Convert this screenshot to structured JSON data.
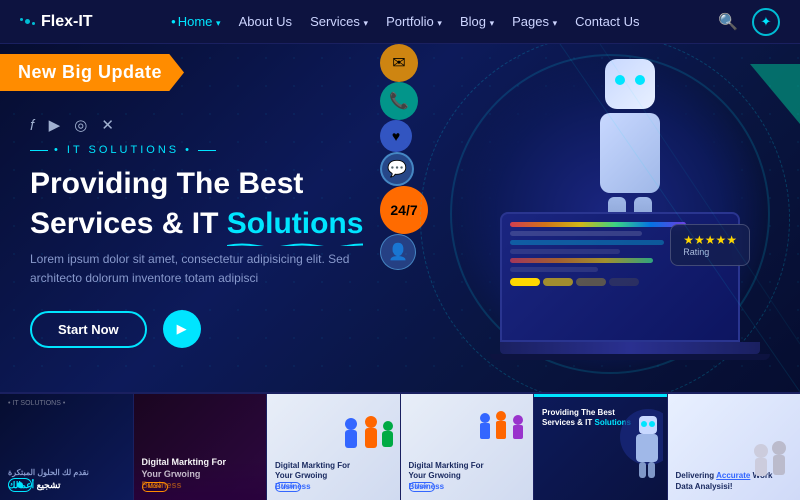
{
  "brand": {
    "name": "Flex-IT"
  },
  "navbar": {
    "items": [
      {
        "label": "Home",
        "active": true
      },
      {
        "label": "About Us",
        "active": false
      },
      {
        "label": "Services",
        "active": false
      },
      {
        "label": "Portfolio",
        "active": false
      },
      {
        "label": "Blog",
        "active": false
      },
      {
        "label": "Pages",
        "active": false
      },
      {
        "label": "Contact Us",
        "active": false
      }
    ]
  },
  "hero": {
    "banner_text": "New Big Update",
    "it_label": "• IT SOLUTIONS •",
    "title_line1": "Providing The Best",
    "title_line2_plain": "Services & IT",
    "title_line2_highlight": "Solutions",
    "description": "Lorem ipsum dolor sit amet, consectetur adipisicing elit. Sed architecto dolorum inventore totam adipisci",
    "cta_button": "Start Now",
    "float_247": "24/7"
  },
  "thumbnails": [
    {
      "id": 1,
      "theme": "dark-blue",
      "text_line1": "نقدم لك الحلول المبتكرة",
      "text_line2": "تشجيع أعمالك",
      "light_text": true,
      "active": false
    },
    {
      "id": 2,
      "theme": "dark-purple",
      "text_line1": "Digital Markting For",
      "text_line2": "Your Grwoing",
      "text_highlight": "Business",
      "light_text": true,
      "active": false
    },
    {
      "id": 3,
      "theme": "light",
      "text_line1": "Digital Markting For",
      "text_line2": "Your Grwoing",
      "text_highlight": "Business",
      "light_text": false,
      "active": false
    },
    {
      "id": 4,
      "theme": "light",
      "text_line1": "Digital Markting For",
      "text_line2": "Your Grwoing",
      "text_highlight": "Business",
      "light_text": false,
      "active": false
    },
    {
      "id": 5,
      "theme": "dark-blue",
      "text_line1": "Providing The Best",
      "text_line2": "Services & IT",
      "text_highlight": "Solutions",
      "light_text": true,
      "active": true
    },
    {
      "id": 6,
      "theme": "light",
      "text_line1": "Delivering",
      "text_highlight": "Accurate",
      "text_line2": "Work",
      "text_line3": "Data Analysisi!",
      "light_text": false,
      "active": false
    }
  ],
  "social": {
    "icons": [
      "facebook",
      "youtube",
      "instagram",
      "twitter-x"
    ]
  }
}
